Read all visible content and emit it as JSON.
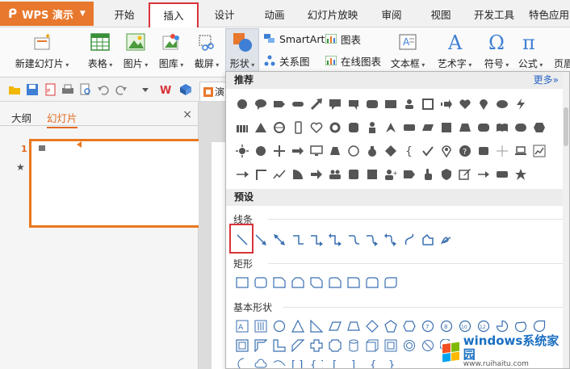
{
  "app": {
    "button_label": "WPS 演示"
  },
  "menu_tabs": [
    {
      "label": "开始"
    },
    {
      "label": "插入"
    },
    {
      "label": "设计"
    },
    {
      "label": "动画"
    },
    {
      "label": "幻灯片放映"
    },
    {
      "label": "审阅"
    },
    {
      "label": "视图"
    },
    {
      "label": "开发工具"
    },
    {
      "label": "特色应用"
    }
  ],
  "active_tab": "插入",
  "ribbon": {
    "new_slide": "新建幻灯片",
    "table": "表格",
    "picture": "图片",
    "gallery": "图库",
    "screenshot": "截屏",
    "shapes": "形状",
    "smartart": "SmartArt",
    "chart": "图表",
    "relation_chart": "关系图",
    "online_chart": "在线图表",
    "textbox": "文本框",
    "wordart": "艺术字",
    "symbol": "符号",
    "formula": "公式",
    "header_footer": "页眉"
  },
  "doc_tab": {
    "label": "演"
  },
  "left_panel": {
    "tab_outline": "大纲",
    "tab_slides": "幻灯片",
    "close": "×",
    "slide_number": "1"
  },
  "shapes_panel": {
    "recommended_header": "推荐",
    "more_link": "更多»",
    "preset_header": "预设",
    "categories": {
      "lines": "线条",
      "rectangles": "矩形",
      "basic": "基本形状"
    }
  },
  "watermark": {
    "title": "windows系统家园",
    "url": "www.ruihaitu.com"
  },
  "colors": {
    "accent_orange": "#e8782d",
    "highlight_red": "#d9333a",
    "link_blue": "#2a66c8"
  }
}
